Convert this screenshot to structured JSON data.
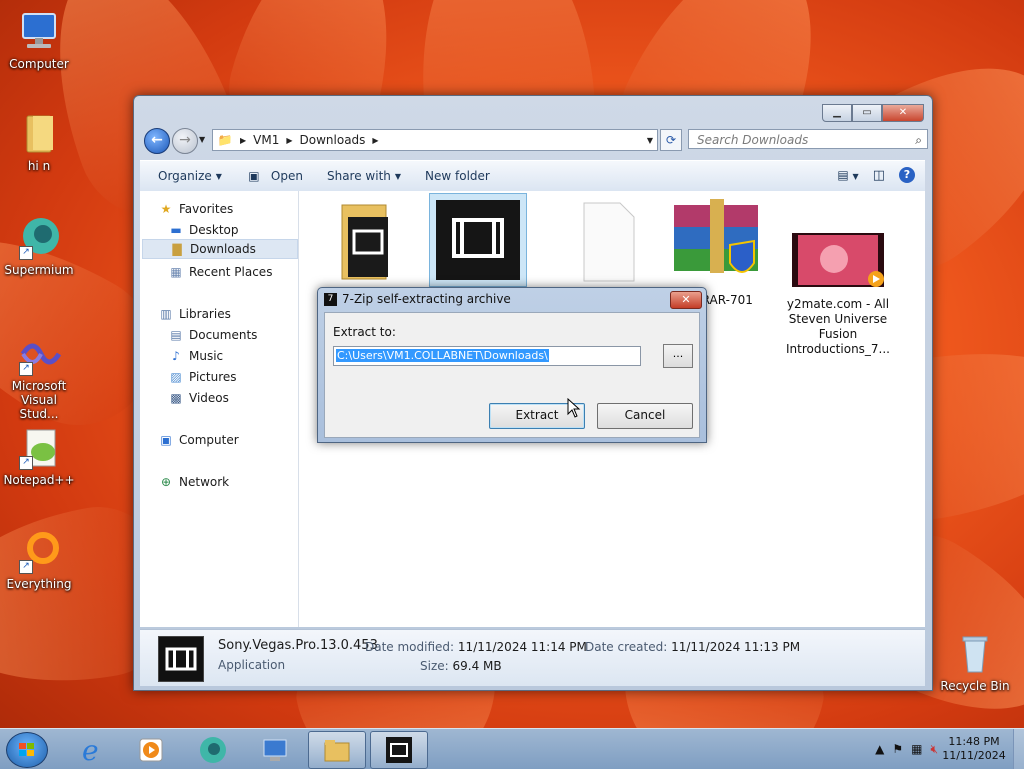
{
  "desktop": {
    "icons": [
      {
        "label": "Computer"
      },
      {
        "label": "hi n"
      },
      {
        "label": "Supermium"
      },
      {
        "label": "Microsoft Visual Stud..."
      },
      {
        "label": "Notepad++"
      },
      {
        "label": "Everything"
      },
      {
        "label": "Recycle Bin"
      }
    ]
  },
  "explorer": {
    "address": [
      "VM1",
      "Downloads"
    ],
    "search_placeholder": "Search Downloads",
    "toolbar": {
      "organize": "Organize",
      "open": "Open",
      "share_with": "Share with",
      "new_folder": "New folder"
    },
    "nav": {
      "favorites": "Favorites",
      "desktop": "Desktop",
      "downloads": "Downloads",
      "recent_places": "Recent Places",
      "libraries": "Libraries",
      "documents": "Documents",
      "music": "Music",
      "pictures": "Pictures",
      "videos": "Videos",
      "computer": "Computer",
      "network": "Network"
    },
    "files": [
      {
        "name": "",
        "kind": "folder-video"
      },
      {
        "name": "",
        "kind": "vegas-app"
      },
      {
        "name": "",
        "kind": "blank-file"
      },
      {
        "name": "WinRAR-701",
        "kind": "winrar"
      },
      {
        "name": "y2mate.com - All Steven Universe Fusion Introductions_7...",
        "kind": "video"
      }
    ],
    "details": {
      "name": "Sony.Vegas.Pro.13.0.453",
      "type": "Application",
      "modified_label": "Date modified:",
      "modified_value": "11/11/2024 11:14 PM",
      "size_label": "Size:",
      "size_value": "69.4 MB",
      "created_label": "Date created:",
      "created_value": "11/11/2024 11:13 PM"
    }
  },
  "dialog": {
    "title": "7-Zip self-extracting archive",
    "extract_label": "Extract to:",
    "path": "C:\\Users\\VM1.COLLABNET\\Downloads\\",
    "browse": "...",
    "extract_button": "Extract",
    "cancel_button": "Cancel"
  },
  "taskbar": {
    "time": "11:48 PM",
    "date": "11/11/2024"
  },
  "colors": {
    "accent": "#1c58b8",
    "selection": "#3399ff",
    "close": "#c43d27"
  }
}
